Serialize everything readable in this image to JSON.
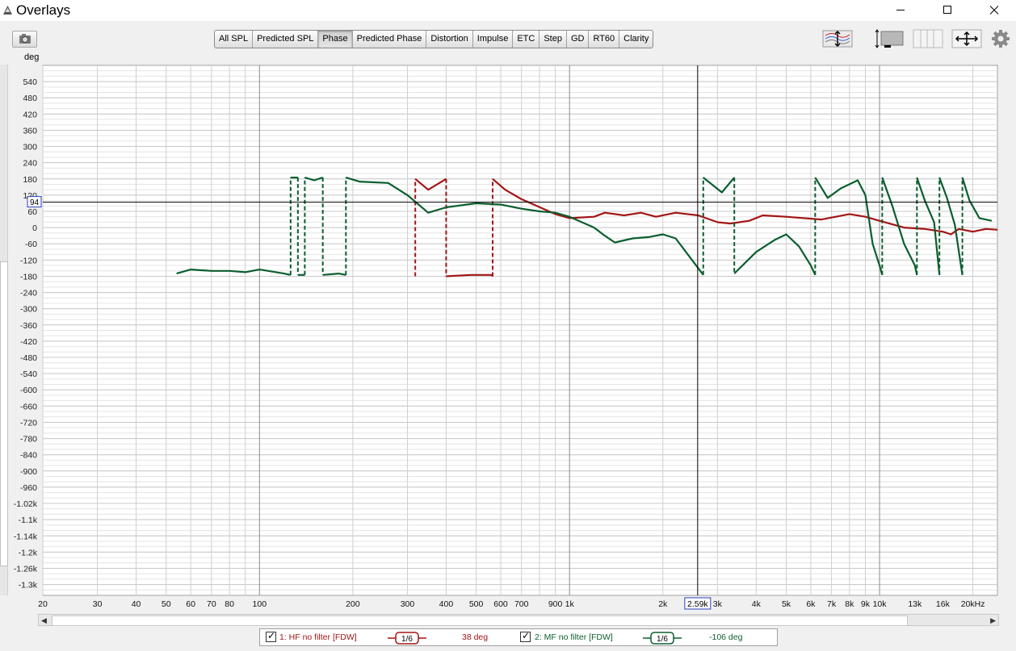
{
  "window": {
    "title": "Overlays"
  },
  "tabs": [
    "All SPL",
    "Predicted SPL",
    "Phase",
    "Predicted Phase",
    "Distortion",
    "Impulse",
    "ETC",
    "Step",
    "GD",
    "RT60",
    "Clarity"
  ],
  "active_tab": "Phase",
  "toolbar_icons": [
    "camera-icon",
    "trace-arrange-icon",
    "vertical-scale-icon",
    "range-icon",
    "zoom-fit-icon",
    "settings-gear-icon"
  ],
  "cursor": {
    "y_readout": "94",
    "x_readout": "2.59k"
  },
  "legend": [
    {
      "label": "1: HF no filter [FDW]",
      "smoothing": "1/6",
      "value": "38 deg",
      "color": "#a31515",
      "checked": true
    },
    {
      "label": "2: MF no filter [FDW]",
      "smoothing": "1/6",
      "value": "-106 deg",
      "color": "#0b5e2e",
      "checked": true
    }
  ],
  "chart_data": {
    "type": "line",
    "xscale": "log",
    "xlim": [
      20,
      24000
    ],
    "ylim": [
      -1360,
      600
    ],
    "ylabel": "deg",
    "yticks": [
      540,
      480,
      420,
      360,
      300,
      240,
      180,
      120,
      60,
      0,
      -60,
      -120,
      -180,
      -240,
      -300,
      -360,
      -420,
      -480,
      -540,
      -600,
      -660,
      -720,
      -780,
      -840,
      -900,
      -960,
      -1020,
      -1080,
      -1140,
      -1200,
      -1260,
      -1320
    ],
    "ytick_labels": [
      "540",
      "480",
      "420",
      "360",
      "300",
      "240",
      "180",
      "120",
      "60",
      "0",
      "-60",
      "-120",
      "-180",
      "-240",
      "-300",
      "-360",
      "-420",
      "-480",
      "-540",
      "-600",
      "-660",
      "-720",
      "-780",
      "-840",
      "-900",
      "-960",
      "-1.02k",
      "-1.1k",
      "-1.14k",
      "-1.2k",
      "-1.26k",
      "-1.3k"
    ],
    "xticks": [
      {
        "v": 20,
        "t": "20"
      },
      {
        "v": 30,
        "t": "30"
      },
      {
        "v": 40,
        "t": "40"
      },
      {
        "v": 50,
        "t": "50"
      },
      {
        "v": 60,
        "t": "60"
      },
      {
        "v": 70,
        "t": "70"
      },
      {
        "v": 80,
        "t": "80"
      },
      {
        "v": 100,
        "t": "100"
      },
      {
        "v": 200,
        "t": "200"
      },
      {
        "v": 300,
        "t": "300"
      },
      {
        "v": 400,
        "t": "400"
      },
      {
        "v": 500,
        "t": "500"
      },
      {
        "v": 600,
        "t": "600"
      },
      {
        "v": 700,
        "t": "700"
      },
      {
        "v": 900,
        "t": "900"
      },
      {
        "v": 1000,
        "t": "1k"
      },
      {
        "v": 2000,
        "t": "2k"
      },
      {
        "v": 3000,
        "t": "3k"
      },
      {
        "v": 4000,
        "t": "4k"
      },
      {
        "v": 5000,
        "t": "5k"
      },
      {
        "v": 6000,
        "t": "6k"
      },
      {
        "v": 7000,
        "t": "7k"
      },
      {
        "v": 8000,
        "t": "8k"
      },
      {
        "v": 9000,
        "t": "9k"
      },
      {
        "v": 10000,
        "t": "10k"
      },
      {
        "v": 13000,
        "t": "13k"
      },
      {
        "v": 16000,
        "t": "16k"
      },
      {
        "v": 20000,
        "t": "20kHz"
      }
    ],
    "cursor": {
      "x": 2590,
      "y": 94
    },
    "series": [
      {
        "name": "1: HF no filter [FDW]",
        "color": "#a31515",
        "points": [
          [
            318,
            -180
          ],
          [
            318,
            180
          ],
          [
            350,
            140
          ],
          [
            400,
            180
          ],
          [
            400,
            -180
          ],
          [
            480,
            -175
          ],
          [
            560,
            -175
          ],
          [
            565,
            -180
          ],
          [
            565,
            180
          ],
          [
            620,
            140
          ],
          [
            700,
            105
          ],
          [
            900,
            50
          ],
          [
            1000,
            35
          ],
          [
            1200,
            40
          ],
          [
            1300,
            55
          ],
          [
            1500,
            45
          ],
          [
            1700,
            55
          ],
          [
            1900,
            40
          ],
          [
            2200,
            55
          ],
          [
            2600,
            45
          ],
          [
            3000,
            20
          ],
          [
            3300,
            15
          ],
          [
            3800,
            25
          ],
          [
            4200,
            45
          ],
          [
            5000,
            40
          ],
          [
            6500,
            30
          ],
          [
            8000,
            50
          ],
          [
            9000,
            40
          ],
          [
            10000,
            25
          ],
          [
            12000,
            0
          ],
          [
            14000,
            -5
          ],
          [
            16000,
            -15
          ],
          [
            17000,
            -25
          ],
          [
            18000,
            -5
          ],
          [
            20000,
            -15
          ],
          [
            22000,
            -5
          ],
          [
            24000,
            -8
          ]
        ]
      },
      {
        "name": "2: MF no filter [FDW]",
        "color": "#0b5e2e",
        "points": [
          [
            54,
            -170
          ],
          [
            60,
            -155
          ],
          [
            70,
            -160
          ],
          [
            80,
            -160
          ],
          [
            90,
            -165
          ],
          [
            100,
            -155
          ],
          [
            120,
            -170
          ],
          [
            126,
            -175
          ],
          [
            126,
            185
          ],
          [
            133,
            185
          ],
          [
            133,
            -175
          ],
          [
            140,
            -175
          ],
          [
            140,
            185
          ],
          [
            150,
            175
          ],
          [
            160,
            185
          ],
          [
            160,
            -175
          ],
          [
            180,
            -170
          ],
          [
            190,
            -175
          ],
          [
            190,
            185
          ],
          [
            210,
            170
          ],
          [
            260,
            165
          ],
          [
            300,
            120
          ],
          [
            350,
            55
          ],
          [
            400,
            75
          ],
          [
            500,
            90
          ],
          [
            600,
            85
          ],
          [
            700,
            70
          ],
          [
            800,
            60
          ],
          [
            900,
            55
          ],
          [
            1000,
            40
          ],
          [
            1200,
            0
          ],
          [
            1300,
            -30
          ],
          [
            1400,
            -55
          ],
          [
            1600,
            -40
          ],
          [
            1800,
            -35
          ],
          [
            2000,
            -25
          ],
          [
            2200,
            -40
          ],
          [
            2600,
            -150
          ],
          [
            2700,
            -175
          ],
          [
            2700,
            185
          ],
          [
            3100,
            130
          ],
          [
            3400,
            185
          ],
          [
            3400,
            -170
          ],
          [
            4000,
            -90
          ],
          [
            4600,
            -45
          ],
          [
            5000,
            -25
          ],
          [
            5500,
            -70
          ],
          [
            6000,
            -140
          ],
          [
            6200,
            -175
          ],
          [
            6200,
            185
          ],
          [
            6800,
            110
          ],
          [
            7500,
            145
          ],
          [
            8500,
            175
          ],
          [
            9000,
            120
          ],
          [
            9500,
            -60
          ],
          [
            10000,
            -140
          ],
          [
            10200,
            -175
          ],
          [
            10200,
            185
          ],
          [
            11000,
            80
          ],
          [
            12000,
            -60
          ],
          [
            13000,
            -140
          ],
          [
            13200,
            -175
          ],
          [
            13200,
            185
          ],
          [
            14000,
            100
          ],
          [
            15000,
            20
          ],
          [
            15600,
            -175
          ],
          [
            15600,
            185
          ],
          [
            16500,
            110
          ],
          [
            17500,
            10
          ],
          [
            18500,
            -175
          ],
          [
            18500,
            185
          ],
          [
            19500,
            100
          ],
          [
            21000,
            35
          ],
          [
            23000,
            25
          ]
        ]
      }
    ]
  }
}
